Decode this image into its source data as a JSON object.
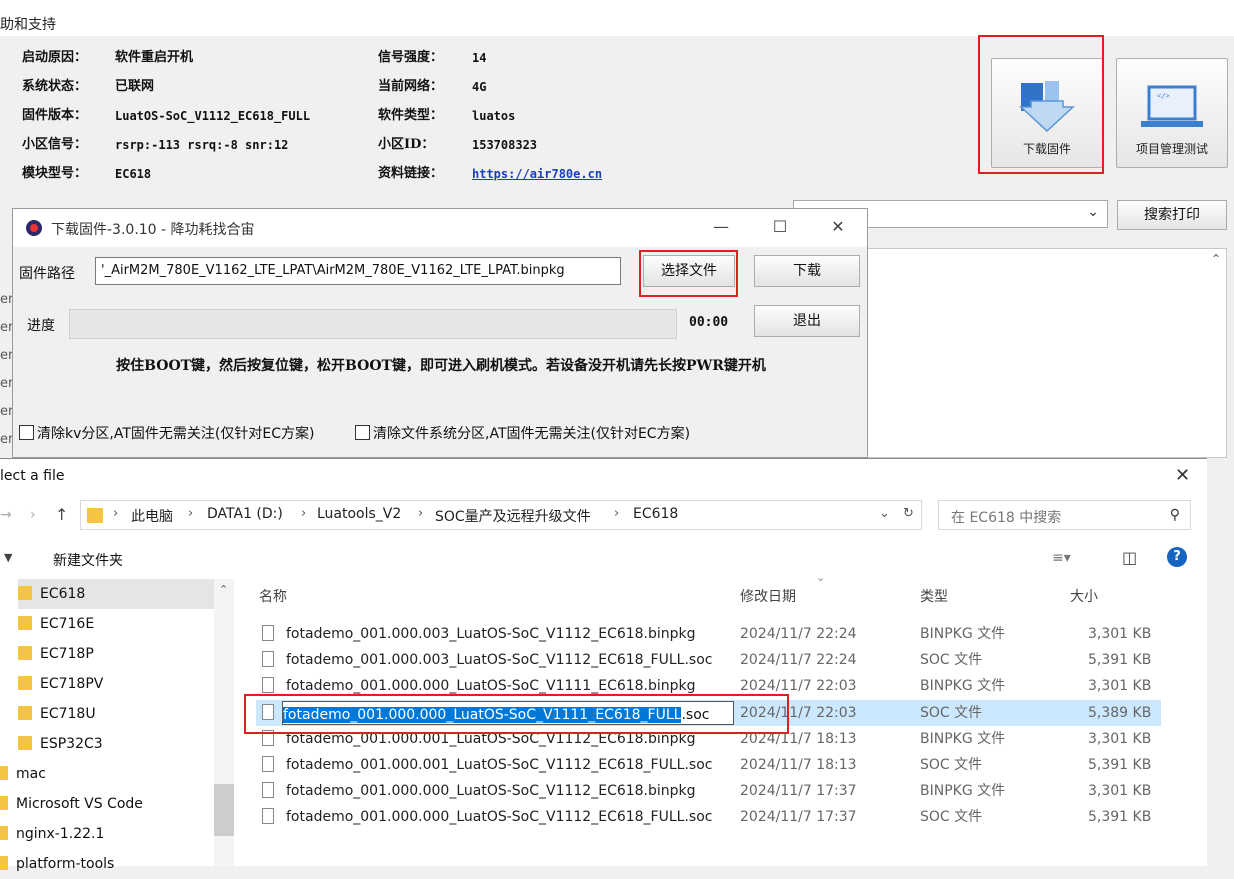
{
  "menu": {
    "help": "助和支持"
  },
  "device": {
    "rows": [
      {
        "label": "启动原因：",
        "value": "软件重启开机",
        "label2": "信号强度：",
        "value2": "14"
      },
      {
        "label": "系统状态：",
        "value": "已联网",
        "label2": "当前网络：",
        "value2": "4G"
      },
      {
        "label": "固件版本：",
        "value": "LuatOS-SoC_V1112_EC618_FULL",
        "label2": "软件类型：",
        "value2": "luatos"
      },
      {
        "label": "小区信号：",
        "value": "rsrp:-113 rsrq:-8 snr:12",
        "label2": "小区ID：",
        "value2": "153708323"
      },
      {
        "label": "模块型号：",
        "value": "EC618",
        "label2": "资料链接：",
        "value2": "https://air780e.cn"
      }
    ]
  },
  "toolbar": {
    "download_firmware": "下载固件",
    "project_test": "项目管理测试",
    "search_print": "搜索打印"
  },
  "log_gutter": [
    "er.",
    "er.",
    "er.",
    "er.",
    "er.",
    "er."
  ],
  "download_dialog": {
    "title": "下载固件-3.0.10 - 降功耗找合宙",
    "path_label": "固件路径",
    "path_value": "'_AirM2M_780E_V1162_LTE_LPAT\\AirM2M_780E_V1162_LTE_LPAT.binpkg",
    "select_file": "选择文件",
    "download": "下载",
    "progress_label": "进度",
    "time": "00:00",
    "exit": "退出",
    "hint": "按住BOOT键，然后按复位键，松开BOOT键，即可进入刷机模式。若设备没开机请先长按PWR键开机",
    "clear_kv": "清除kv分区,AT固件无需关注(仅针对EC方案)",
    "clear_fs": "清除文件系统分区,AT固件无需关注(仅针对EC方案)"
  },
  "file_dialog": {
    "title": "lect a file",
    "breadcrumbs": [
      "此电脑",
      "DATA1 (D:)",
      "Luatools_V2",
      "SOC量产及远程升级文件",
      "EC618"
    ],
    "search_placeholder": "在 EC618 中搜索",
    "new_folder": "新建文件夹",
    "columns": {
      "name": "名称",
      "date": "修改日期",
      "type": "类型",
      "size": "大小"
    },
    "tree": [
      "EC618",
      "EC716E",
      "EC718P",
      "EC718PV",
      "EC718U",
      "ESP32C3",
      "mac",
      "Microsoft VS Code",
      "nginx-1.22.1",
      "platform-tools"
    ],
    "files": [
      {
        "name": "fotademo_001.000.003_LuatOS-SoC_V1112_EC618.binpkg",
        "date": "2024/11/7 22:24",
        "type": "BINPKG 文件",
        "size": "3,301 KB"
      },
      {
        "name": "fotademo_001.000.003_LuatOS-SoC_V1112_EC618_FULL.soc",
        "date": "2024/11/7 22:24",
        "type": "SOC 文件",
        "size": "5,391 KB"
      },
      {
        "name": "fotademo_001.000.000_LuatOS-SoC_V1111_EC618.binpkg",
        "date": "2024/11/7 22:03",
        "type": "BINPKG 文件",
        "size": "3,301 KB"
      },
      {
        "name": "fotademo_001.000.000_LuatOS-SoC_V1111_EC618_FULL.soc",
        "name_selected": "fotademo_001.000.000_LuatOS-SoC_V1111_EC618_FULL",
        "name_ext": ".soc",
        "date": "2024/11/7 22:03",
        "type": "SOC 文件",
        "size": "5,389 KB"
      },
      {
        "name": "fotademo_001.000.001_LuatOS-SoC_V1112_EC618.binpkg",
        "date": "2024/11/7 18:13",
        "type": "BINPKG 文件",
        "size": "3,301 KB"
      },
      {
        "name": "fotademo_001.000.001_LuatOS-SoC_V1112_EC618_FULL.soc",
        "date": "2024/11/7 18:13",
        "type": "SOC 文件",
        "size": "5,391 KB"
      },
      {
        "name": "fotademo_001.000.000_LuatOS-SoC_V1112_EC618.binpkg",
        "date": "2024/11/7 17:37",
        "type": "BINPKG 文件",
        "size": "3,301 KB"
      },
      {
        "name": "fotademo_001.000.000_LuatOS-SoC_V1112_EC618_FULL.soc",
        "date": "2024/11/7 17:37",
        "type": "SOC 文件",
        "size": "5,391 KB"
      }
    ]
  },
  "colors": {
    "highlight_red": "#e02020",
    "selection": "#cce8ff",
    "text_select": "#0078d7",
    "folder": "#f6c443",
    "link": "#1a3fbf"
  }
}
